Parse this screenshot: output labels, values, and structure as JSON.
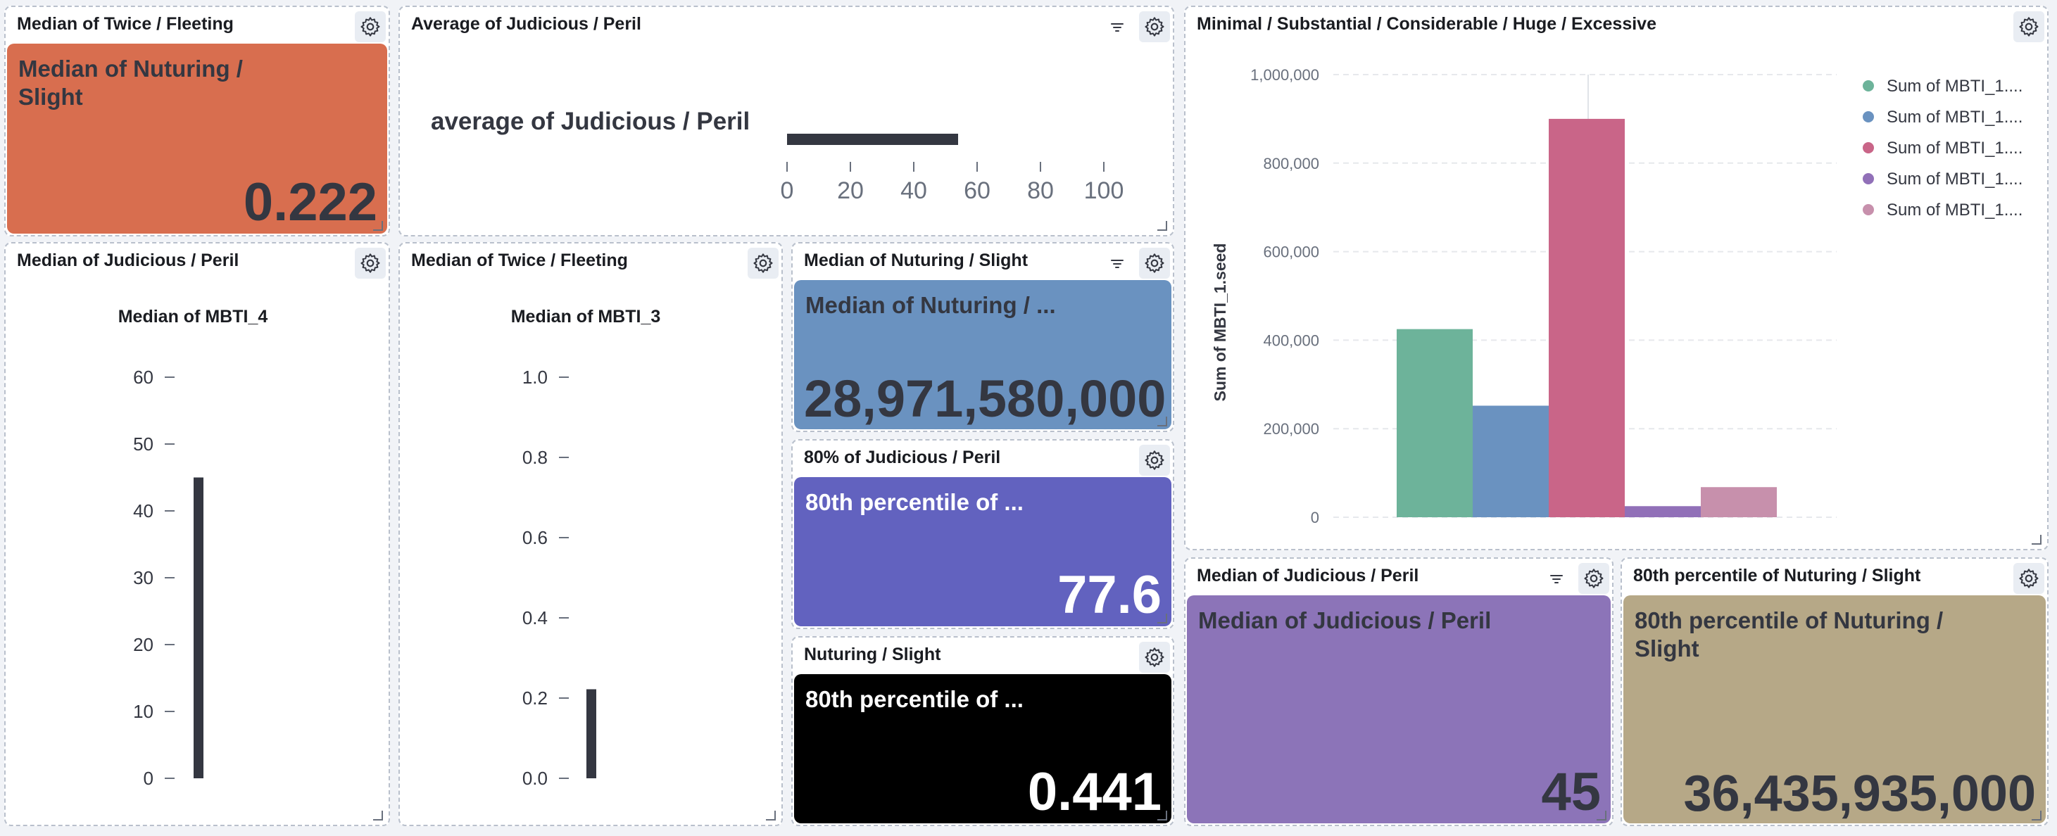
{
  "colors": {
    "orange_metric": "#d86e4f",
    "blue_metric": "#6a92c0",
    "indigo_metric": "#6262bf",
    "black_metric": "#000000",
    "purple_metric": "#8c74b8",
    "tan_metric": "#b6a887",
    "bar_dark": "#343741"
  },
  "icons": {
    "gear": "gear-icon",
    "filter": "filter-icon",
    "resize": "resize-handle-icon"
  },
  "panels": {
    "p1": {
      "title": "Median of Twice / Fleeting",
      "label_line1": "Median of Nuturing /",
      "label_line2": "Slight",
      "value": "0.222"
    },
    "p2": {
      "title": "Average of Judicious / Peril",
      "label": "average of Judicious / Peril",
      "value": 54,
      "ticks": [
        "0",
        "20",
        "40",
        "60",
        "80",
        "100"
      ]
    },
    "p3": {
      "title": "Median of Judicious / Peril",
      "chart_title": "Median of MBTI_4",
      "value": 45,
      "ticks": [
        "0",
        "10",
        "20",
        "30",
        "40",
        "50",
        "60"
      ]
    },
    "p4": {
      "title": "Median of Twice / Fleeting",
      "chart_title": "Median of MBTI_3",
      "value": 0.222,
      "ticks": [
        "0.0",
        "0.2",
        "0.4",
        "0.6",
        "0.8",
        "1.0"
      ]
    },
    "p5": {
      "title": "Median of Nuturing / Slight",
      "label": "Median of Nuturing / ...",
      "value": "28,971,580,000"
    },
    "p6": {
      "title": "80% of Judicious / Peril",
      "label": "80th percentile of ...",
      "value": "77.6"
    },
    "p7": {
      "title": "Nuturing / Slight",
      "label": "80th percentile of ...",
      "value": "0.441"
    },
    "p9": {
      "title": "Median of Judicious / Peril",
      "label": "Median of Judicious / Peril",
      "value": "45"
    },
    "p10": {
      "title": "80th percentile of Nuturing / Slight",
      "label_line1": "80th percentile of Nuturing /",
      "label_line2": "Slight",
      "value": "36,435,935,000"
    },
    "p8": {
      "title": "Minimal / Substantial / Considerable / Huge / Excessive"
    }
  },
  "chart_data": [
    {
      "type": "bar",
      "ylabel": "Sum of MBTI_1.seed",
      "ylim": [
        0,
        1000000
      ],
      "yticks": [
        "0",
        "200,000",
        "400,000",
        "600,000",
        "800,000",
        "1,000,000"
      ],
      "grid": true,
      "legend_position": "top-right",
      "series": [
        {
          "name": "Sum of MBTI_1....",
          "value": 425000,
          "color": "#6db39a"
        },
        {
          "name": "Sum of MBTI_1....",
          "value": 252000,
          "color": "#6a92c0"
        },
        {
          "name": "Sum of MBTI_1....",
          "value": 900000,
          "color": "#c96588"
        },
        {
          "name": "Sum of MBTI_1....",
          "value": 25000,
          "color": "#9170b8"
        },
        {
          "name": "Sum of MBTI_1....",
          "value": 68000,
          "color": "#c790ac"
        }
      ]
    }
  ]
}
